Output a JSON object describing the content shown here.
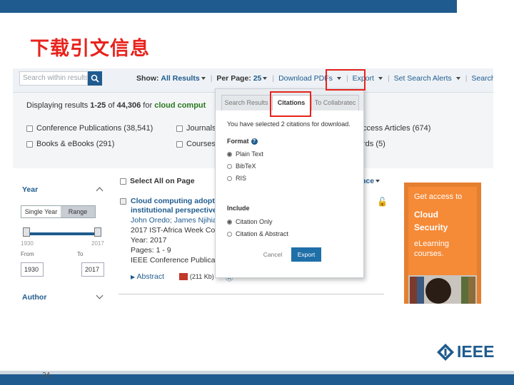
{
  "slide": {
    "title": "下载引文信息",
    "page_number": "34"
  },
  "header": {
    "search_placeholder": "Search within results",
    "show_label": "Show:",
    "show_value": "All Results",
    "per_page_label": "Per Page:",
    "per_page_value": "25",
    "download_pdfs": "Download PDFs",
    "export": "Export",
    "set_search_alerts": "Set Search Alerts",
    "search_history": "Search History"
  },
  "filters": {
    "displaying_prefix": "Displaying results ",
    "range": "1-25",
    "of": " of ",
    "total": "44,306",
    "for": " for ",
    "query": "cloud comput",
    "items": [
      {
        "label": "Conference Publications (38,541)"
      },
      {
        "label": "Books & eBooks (291)"
      },
      {
        "label": "Journals"
      },
      {
        "label": "Courses"
      },
      {
        "label": "ccess Articles (674)"
      },
      {
        "label": "rds (5)"
      }
    ]
  },
  "left_panel": {
    "year_title": "Year",
    "single_year": "Single Year",
    "range": "Range",
    "min_label": "1930",
    "max_label": "2017",
    "from_label": "From",
    "to_label": "To",
    "from_value": "1930",
    "to_value": "2017",
    "author_title": "Author"
  },
  "results": {
    "select_all": "Select All on Page",
    "sort_suffix": "nce",
    "title_line1": "Cloud computing adopti",
    "title_line2": "institutional perspective",
    "authors": "John Oredo; James Njihia",
    "venue": "2017 IST-Africa Week Con",
    "year": "Year: 2017",
    "pages": "Pages: 1 - 9",
    "pub_type": "IEEE Conference Publicat",
    "abstract": "Abstract",
    "pdf_size": "(211 Kb)"
  },
  "ad": {
    "line1": "Get access to",
    "line2": "Cloud",
    "line3": "Security",
    "line4": "eLearning",
    "line5": "courses."
  },
  "modal": {
    "tabs": [
      "Search Results",
      "Citations",
      "To Collabratec"
    ],
    "selected_text": "You have selected 2 citations for download.",
    "format_label": "Format",
    "formats": [
      "Plain Text",
      "BibTeX",
      "RIS"
    ],
    "include_label": "Include",
    "includes": [
      "Citation Only",
      "Citation & Abstract"
    ],
    "cancel": "Cancel",
    "export": "Export"
  },
  "logo": {
    "text": "IEEE"
  }
}
